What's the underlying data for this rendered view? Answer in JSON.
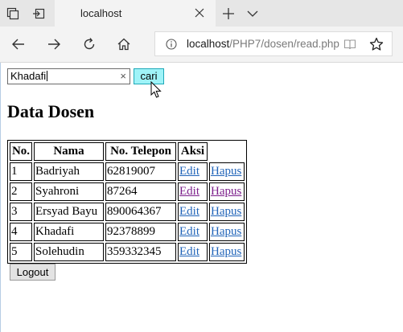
{
  "browser": {
    "tab_title": "localhost",
    "url_host": "localhost",
    "url_path": "/PHP7/dosen/read.php"
  },
  "search": {
    "value": "Khadafi",
    "clear_glyph": "×",
    "button_label": "cari",
    "button_color": "#9ff3f8"
  },
  "page": {
    "title": "Data Dosen",
    "logout_label": "Logout"
  },
  "table": {
    "headers": [
      "No.",
      "Nama",
      "No. Telepon",
      "Aksi"
    ],
    "rows": [
      {
        "no": "1",
        "nama": "Badriyah",
        "telepon": "62819007",
        "edit": "Edit",
        "hapus": "Hapus",
        "visited": false
      },
      {
        "no": "2",
        "nama": "Syahroni",
        "telepon": "87264",
        "edit": "Edit",
        "hapus": "Hapus",
        "visited": true
      },
      {
        "no": "3",
        "nama": "Ersyad Bayu",
        "telepon": "890064367",
        "edit": "Edit",
        "hapus": "Hapus",
        "visited": false
      },
      {
        "no": "4",
        "nama": "Khadafi",
        "telepon": "92378899",
        "edit": "Edit",
        "hapus": "Hapus",
        "visited": false
      },
      {
        "no": "5",
        "nama": "Solehudin",
        "telepon": "359332345",
        "edit": "Edit",
        "hapus": "Hapus",
        "visited": false
      }
    ]
  },
  "icons": {
    "tab_actions": "tab-actions-icon",
    "set_aside": "set-aside-tabs-icon",
    "close": "close-icon",
    "new_tab": "plus-icon",
    "tab_list": "chevron-down-icon",
    "back": "back-arrow-icon",
    "forward": "forward-arrow-icon",
    "refresh": "refresh-icon",
    "home": "home-icon",
    "info": "info-icon",
    "reading_view": "reading-view-icon",
    "favorite": "star-icon"
  },
  "colors": {
    "link": "#1f63b8",
    "visited_link": "#7b1d8a"
  }
}
